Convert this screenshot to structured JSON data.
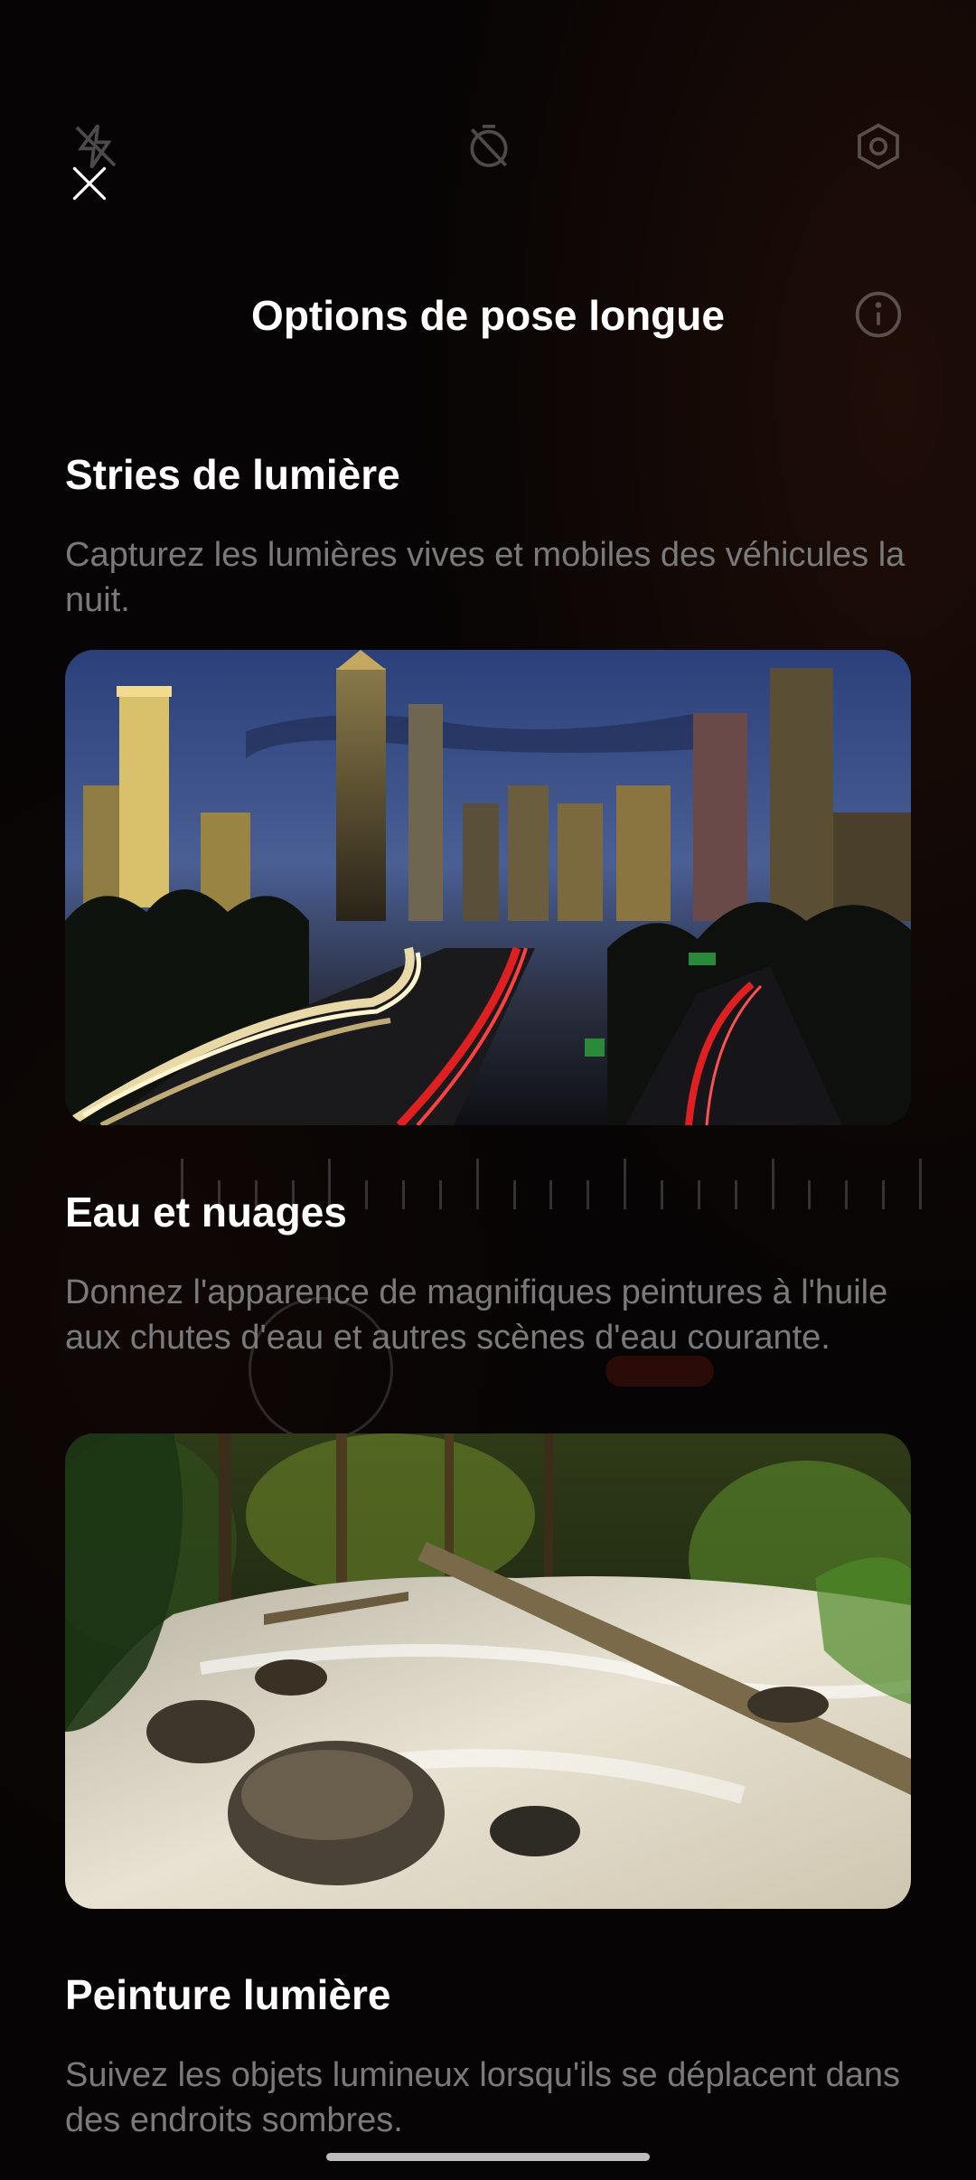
{
  "sheet": {
    "title": "Options de pose longue"
  },
  "close_button": {
    "icon": "close-icon"
  },
  "background_icons": [
    "flash-off-icon",
    "timer-off-icon",
    "settings-hexagon-icon",
    "info-icon"
  ],
  "sections": [
    {
      "title": "Stries de lumière",
      "description": "Capturez les lumières vives et mobiles des véhicules la nuit.",
      "image": "city-night-light-trails"
    },
    {
      "title": "Eau et nuages",
      "description": "Donnez l'apparence de magnifiques peintures à l'huile aux chutes d'eau et autres scènes d'eau courante.",
      "image": "forest-waterfall-stream"
    },
    {
      "title": "Peinture lumière",
      "description": "Suivez les objets lumineux lorsqu'ils se déplacent dans des endroits sombres."
    }
  ],
  "colors": {
    "background": "#060404",
    "title": "#ffffff",
    "description": "#7a7a7a"
  }
}
